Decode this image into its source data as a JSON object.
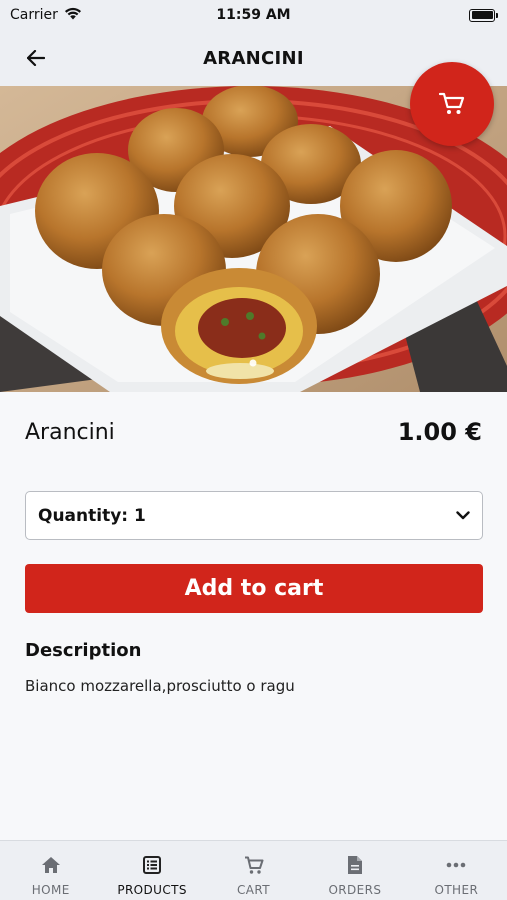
{
  "status_bar": {
    "carrier": "Carrier",
    "time": "11:59 AM"
  },
  "nav": {
    "title": "ARANCINI"
  },
  "product": {
    "name": "Arancini",
    "price": "1.00 €",
    "quantity_label": "Quantity: 1",
    "add_to_cart_label": "Add to cart",
    "description_heading": "Description",
    "description_text": "Bianco mozzarella,prosciutto o ragu"
  },
  "tabs": [
    {
      "label": "HOME",
      "icon": "home-icon"
    },
    {
      "label": "PRODUCTS",
      "icon": "list-icon",
      "active": true
    },
    {
      "label": "CART",
      "icon": "cart-icon"
    },
    {
      "label": "ORDERS",
      "icon": "document-icon"
    },
    {
      "label": "OTHER",
      "icon": "more-icon"
    }
  ],
  "colors": {
    "accent": "#d1251b",
    "background": "#f7f8fa",
    "bar_background": "#edeff3"
  }
}
